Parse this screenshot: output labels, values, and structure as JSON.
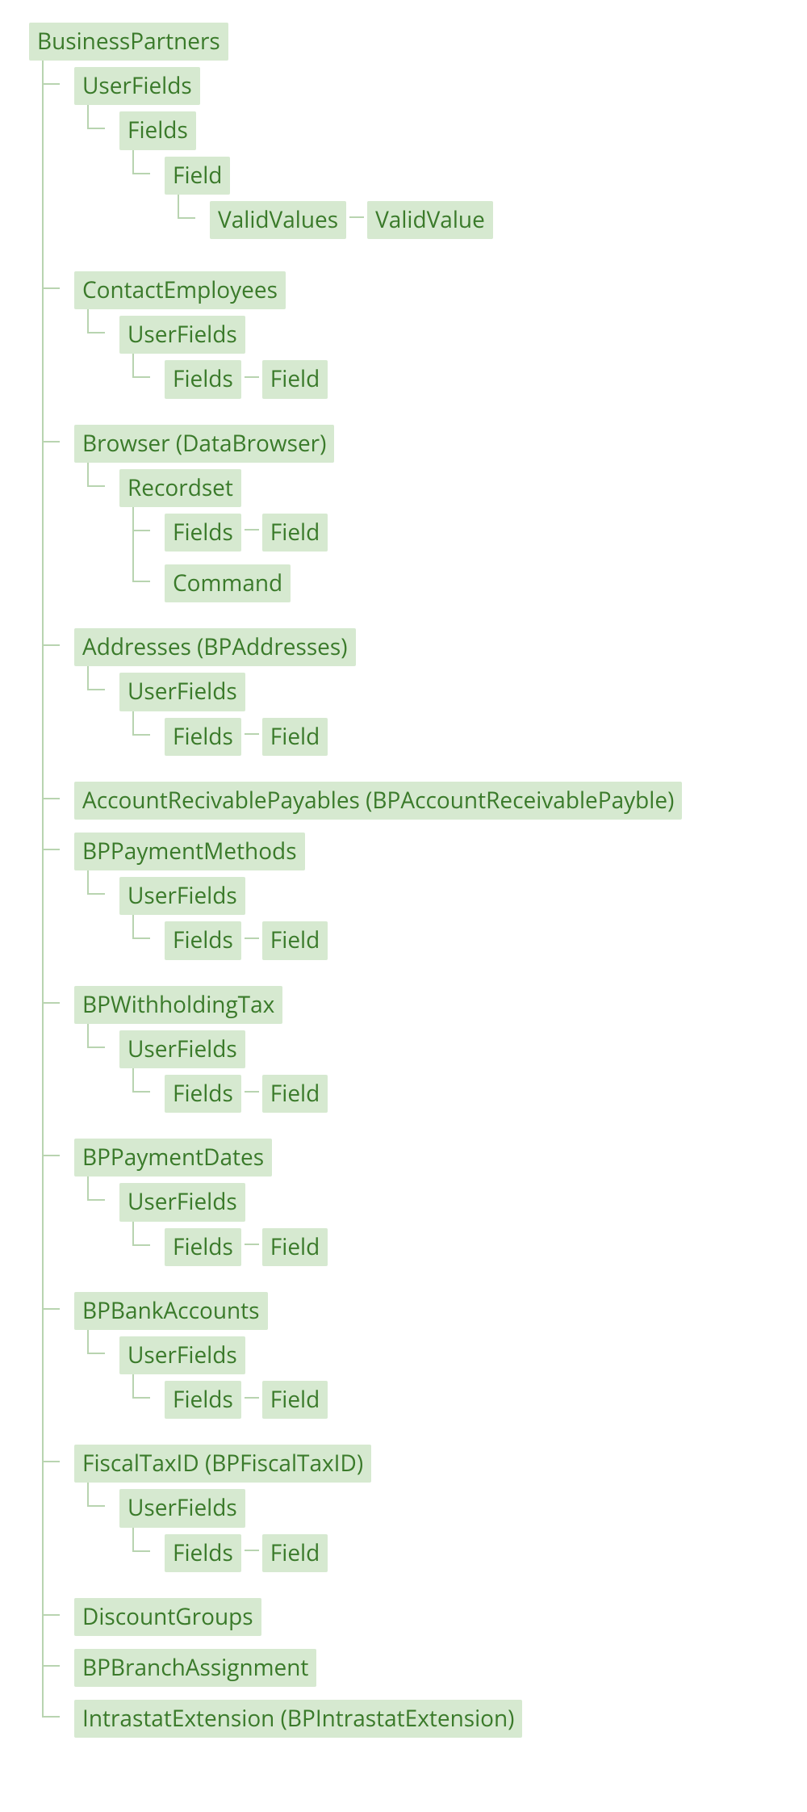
{
  "tree": {
    "label": "BusinessPartners",
    "children": [
      {
        "label": "UserFields",
        "children": [
          {
            "label": "Fields",
            "children": [
              {
                "label": "Field",
                "children": [
                  {
                    "label": "ValidValues",
                    "inlineChild": {
                      "label": "ValidValue"
                    }
                  }
                ]
              }
            ]
          }
        ]
      },
      {
        "label": "ContactEmployees",
        "children": [
          {
            "label": "UserFields",
            "children": [
              {
                "label": "Fields",
                "inlineChild": {
                  "label": "Field"
                }
              }
            ]
          }
        ]
      },
      {
        "label": "Browser (DataBrowser)",
        "children": [
          {
            "label": "Recordset",
            "children": [
              {
                "label": "Fields",
                "inlineChild": {
                  "label": "Field"
                }
              },
              {
                "label": "Command"
              }
            ]
          }
        ]
      },
      {
        "label": "Addresses (BPAddresses)",
        "children": [
          {
            "label": "UserFields",
            "children": [
              {
                "label": "Fields",
                "inlineChild": {
                  "label": "Field"
                }
              }
            ]
          }
        ]
      },
      {
        "label": "AccountRecivablePayables (BPAccountReceivablePayble)"
      },
      {
        "label": "BPPaymentMethods",
        "children": [
          {
            "label": "UserFields",
            "children": [
              {
                "label": "Fields",
                "inlineChild": {
                  "label": "Field"
                }
              }
            ]
          }
        ]
      },
      {
        "label": "BPWithholdingTax",
        "children": [
          {
            "label": "UserFields",
            "children": [
              {
                "label": "Fields",
                "inlineChild": {
                  "label": "Field"
                }
              }
            ]
          }
        ]
      },
      {
        "label": "BPPaymentDates",
        "children": [
          {
            "label": "UserFields",
            "children": [
              {
                "label": "Fields",
                "inlineChild": {
                  "label": "Field"
                }
              }
            ]
          }
        ]
      },
      {
        "label": "BPBankAccounts",
        "children": [
          {
            "label": "UserFields",
            "children": [
              {
                "label": "Fields",
                "inlineChild": {
                  "label": "Field"
                }
              }
            ]
          }
        ]
      },
      {
        "label": "FiscalTaxID (BPFiscalTaxID)",
        "children": [
          {
            "label": "UserFields",
            "children": [
              {
                "label": "Fields",
                "inlineChild": {
                  "label": "Field"
                }
              }
            ]
          }
        ]
      },
      {
        "label": "DiscountGroups"
      },
      {
        "label": "BPBranchAssignment"
      },
      {
        "label": "IntrastatExtension (BPIntrastatExtension)"
      }
    ]
  }
}
